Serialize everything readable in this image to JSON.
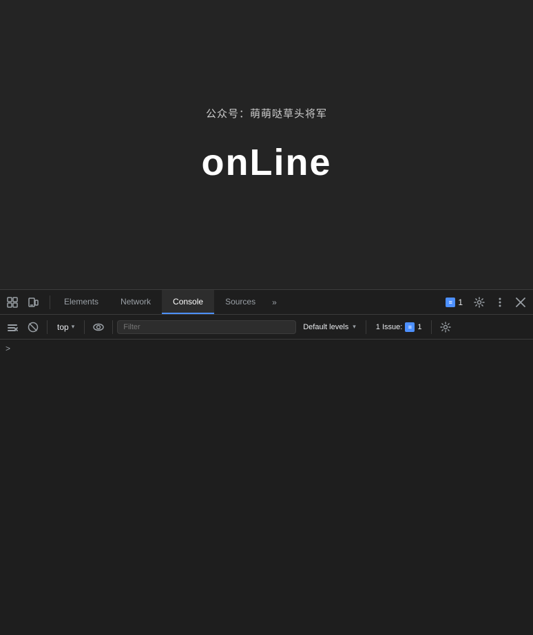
{
  "page": {
    "wechat_label": "公众号：萌萌哒草头将军",
    "main_title": "onLine",
    "bg_color": "#242424"
  },
  "devtools": {
    "tabs": [
      {
        "id": "elements",
        "label": "Elements",
        "active": false
      },
      {
        "id": "network",
        "label": "Network",
        "active": false
      },
      {
        "id": "console",
        "label": "Console",
        "active": true
      },
      {
        "id": "sources",
        "label": "Sources",
        "active": false
      }
    ],
    "tab_more_label": "»",
    "badge_count": "1",
    "toolbar": {
      "context_label": "top",
      "filter_placeholder": "Filter",
      "levels_label": "Default levels",
      "issues_text": "1 Issue:",
      "issues_count": "1"
    },
    "console_prompt": ">"
  },
  "icons": {
    "inspect": "⊡",
    "device": "▭",
    "clear": "🚫",
    "eye": "👁",
    "gear": "⚙",
    "more": "⋮",
    "close": "✕",
    "chevron": "▾",
    "settings2": "⚙",
    "arrow_right": "›"
  }
}
